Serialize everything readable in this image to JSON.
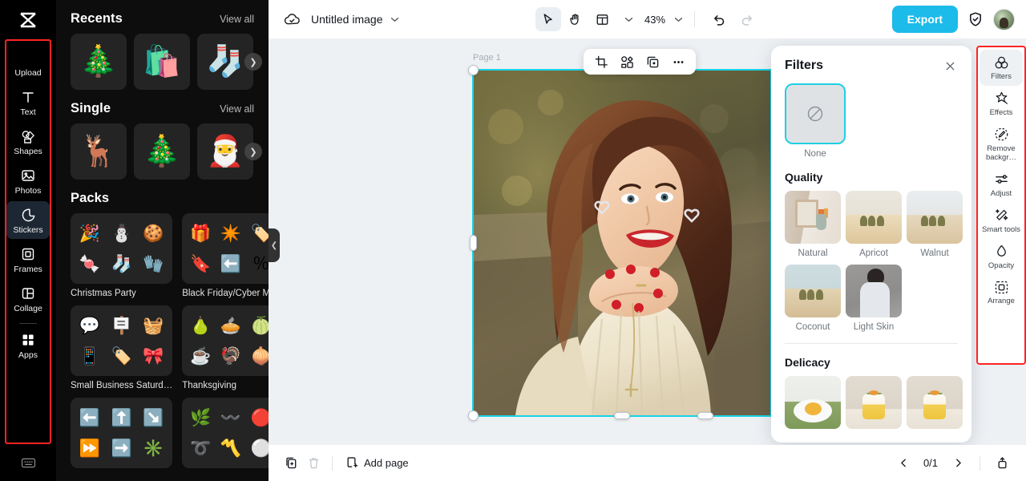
{
  "app": {
    "logo_icon": "capcut-logo-icon"
  },
  "left_rail": {
    "items": [
      {
        "label": "Upload",
        "icon": "upload-icon",
        "active": false
      },
      {
        "label": "Text",
        "icon": "text-icon",
        "active": false
      },
      {
        "label": "Shapes",
        "icon": "shapes-icon",
        "active": false
      },
      {
        "label": "Photos",
        "icon": "photos-icon",
        "active": false
      },
      {
        "label": "Stickers",
        "icon": "stickers-icon",
        "active": true
      },
      {
        "label": "Frames",
        "icon": "frames-icon",
        "active": false
      },
      {
        "label": "Collage",
        "icon": "collage-icon",
        "active": false
      },
      {
        "label": "Apps",
        "icon": "apps-icon",
        "active": false
      }
    ],
    "bottom_icon": "keyboard-icon"
  },
  "sticker_panel": {
    "sections": [
      {
        "title": "Recents",
        "view_all": "View all"
      },
      {
        "title": "Single",
        "view_all": "View all"
      },
      {
        "title": "Packs",
        "view_all": ""
      }
    ],
    "recents": [
      "🎄",
      "🛍️",
      "🧦"
    ],
    "single": [
      "🦌",
      "🎄",
      "🎅"
    ],
    "packs": [
      {
        "name": "Christmas Party",
        "stickers": [
          "🎉",
          "⛄",
          "🍪",
          "🍬",
          "🧦",
          "🧤"
        ]
      },
      {
        "name": "Black Friday/Cyber M…",
        "stickers": [
          "🎁",
          "✴️",
          "🏷️",
          "🔖",
          "⬅️",
          "％"
        ]
      },
      {
        "name": "Small Business Saturd…",
        "stickers": [
          "💬",
          "🪧",
          "🧺",
          "📱",
          "🏷️",
          "🎀"
        ]
      },
      {
        "name": "Thanksgiving",
        "stickers": [
          "🍐",
          "🥧",
          "🍈",
          "☕",
          "🦃",
          "🧅"
        ]
      },
      {
        "name": "",
        "stickers": [
          "⬅️",
          "⬆️",
          "↘️",
          "⏩",
          "➡️",
          "✳️"
        ]
      },
      {
        "name": "",
        "stickers": [
          "🌿",
          "〰️",
          "🔴",
          "➰",
          "〽️",
          "⚪"
        ]
      }
    ],
    "collapse_icon": "chevron-left-icon"
  },
  "topbar": {
    "cloud_icon": "cloud-saved-icon",
    "doc_name": "Untitled image",
    "doc_caret_icon": "chevron-down-icon",
    "tools": [
      {
        "name": "select",
        "icon": "cursor-icon",
        "selected": true
      },
      {
        "name": "hand",
        "icon": "hand-icon",
        "selected": false
      },
      {
        "name": "layout",
        "icon": "layout-icon",
        "selected": false
      }
    ],
    "layout_caret_icon": "chevron-down-icon",
    "zoom": "43%",
    "zoom_caret_icon": "chevron-down-icon",
    "undo_icon": "undo-icon",
    "redo_icon": "redo-icon",
    "export_label": "Export",
    "shield_icon": "shield-check-icon",
    "avatar_icon": "user-avatar"
  },
  "canvas": {
    "page_label": "Page 1",
    "float_toolbar": [
      {
        "name": "crop",
        "icon": "crop-icon"
      },
      {
        "name": "cutout",
        "icon": "cutout-icon"
      },
      {
        "name": "duplicate",
        "icon": "duplicate-icon"
      },
      {
        "name": "more",
        "icon": "more-icon"
      }
    ]
  },
  "filters_panel": {
    "title": "Filters",
    "close_icon": "close-icon",
    "none": {
      "label": "None",
      "icon": "none-icon",
      "selected": true
    },
    "sections": [
      {
        "title": "Quality",
        "items": [
          {
            "label": "Natural",
            "art": "th-room"
          },
          {
            "label": "Apricot",
            "art": "th-desert warm"
          },
          {
            "label": "Walnut",
            "art": "th-desert"
          },
          {
            "label": "Coconut",
            "art": "th-desert cool"
          },
          {
            "label": "Light Skin",
            "art": "th-skin"
          }
        ]
      },
      {
        "title": "Delicacy",
        "items": [
          {
            "label": "",
            "art": "th-tart"
          },
          {
            "label": "",
            "art": "th-cake"
          },
          {
            "label": "",
            "art": "th-cake"
          }
        ]
      }
    ]
  },
  "right_rail": {
    "items": [
      {
        "label": "Filters",
        "icon": "filters-icon",
        "active": true
      },
      {
        "label": "Effects",
        "icon": "effects-icon",
        "active": false
      },
      {
        "label": "Remove backgr…",
        "icon": "remove-background-icon",
        "active": false
      },
      {
        "label": "Adjust",
        "icon": "adjust-icon",
        "active": false
      },
      {
        "label": "Smart tools",
        "icon": "smart-tools-icon",
        "active": false
      },
      {
        "label": "Opacity",
        "icon": "opacity-icon",
        "active": false
      },
      {
        "label": "Arrange",
        "icon": "arrange-icon",
        "active": false
      }
    ]
  },
  "bottombar": {
    "duplicate_page_icon": "duplicate-page-icon",
    "delete_page_icon": "trash-icon",
    "add_page_icon": "add-page-icon",
    "add_page_label": "Add page",
    "prev_icon": "chevron-left-icon",
    "pager": "0/1",
    "next_icon": "chevron-right-icon",
    "pages_panel_icon": "pages-panel-icon"
  },
  "colors": {
    "accent": "#1cbbe9",
    "selection": "#19d3e6",
    "highlight_box": "#ff2424",
    "panel_dark": "#0d0d0d",
    "canvas_bg": "#eef1f4"
  }
}
